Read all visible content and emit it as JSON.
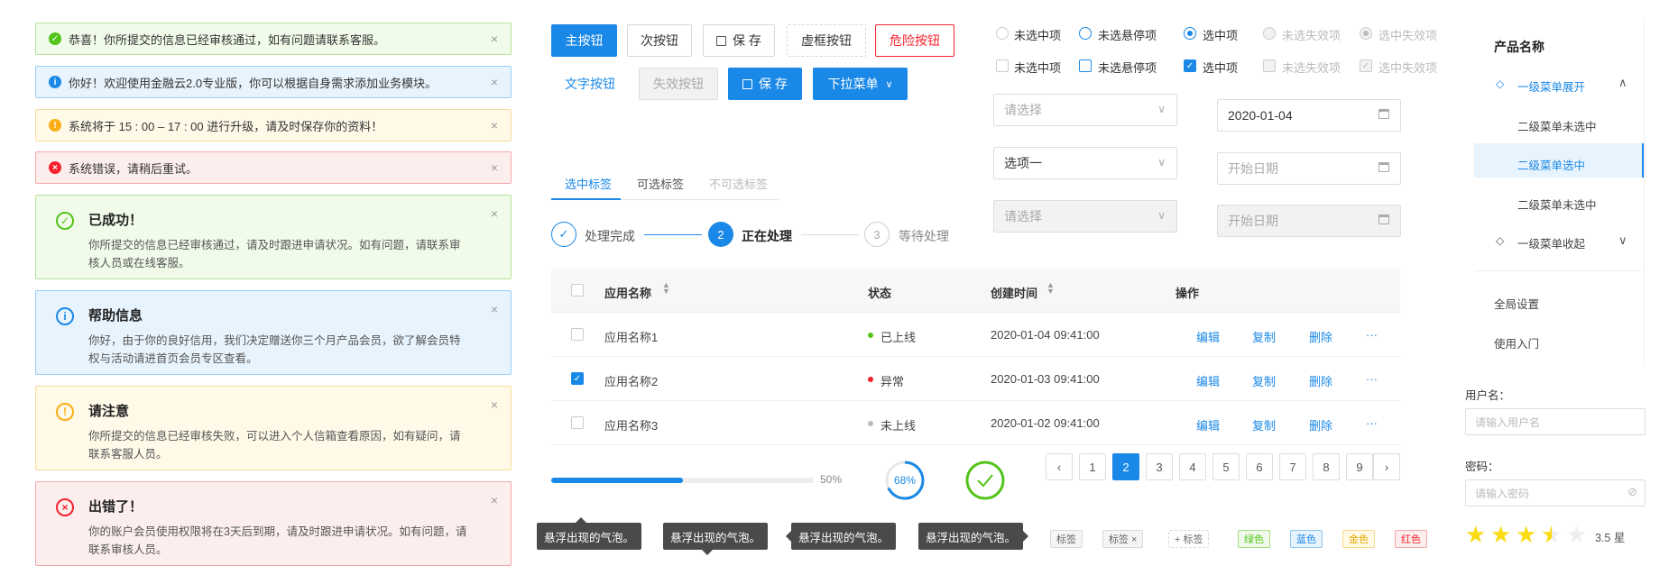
{
  "alerts_small": [
    {
      "type": "success",
      "text": "恭喜！你所提交的信息已经审核通过，如有问题请联系客服。"
    },
    {
      "type": "info",
      "text": "你好！欢迎使用金融云2.0专业版，你可以根据自身需求添加业务模块。"
    },
    {
      "type": "warning",
      "text": "系统将于 15 : 00 – 17 : 00 进行升级，请及时保存你的资料！"
    },
    {
      "type": "error",
      "text": "系统错误，请稍后重试。"
    }
  ],
  "alerts_big": [
    {
      "type": "success",
      "title": "已成功！",
      "desc": "你所提交的信息已经审核通过，请及时跟进申请状况。如有问题，请联系审核人员或在线客服。"
    },
    {
      "type": "info",
      "title": "帮助信息",
      "desc": "你好，由于你的良好信用，我们决定赠送你三个月产品会员，欲了解会员特权与活动请进首页会员专区查看。"
    },
    {
      "type": "warning",
      "title": "请注意",
      "desc": "你所提交的信息已经审核失败，可以进入个人信箱查看原因，如有疑问，请联系客服人员。"
    },
    {
      "type": "error",
      "title": "出错了！",
      "desc": "你的账户会员使用权限将在3天后到期，请及时跟进申请状况。如有问题，请联系审核人员。"
    }
  ],
  "alert_close": "×",
  "buttons": {
    "primary": "主按钮",
    "secondary": "次按钮",
    "save": "保 存",
    "dashed": "虚框按钮",
    "danger": "危险按钮",
    "text": "文字按钮",
    "disabled": "失效按钮",
    "save_primary": "保 存",
    "dropdown": "下拉菜单"
  },
  "tabs": [
    "选中标签",
    "可选标签",
    "不可选标签"
  ],
  "steps": [
    {
      "label": "处理完成",
      "num": "✓"
    },
    {
      "label": "正在处理",
      "num": "2"
    },
    {
      "label": "等待处理",
      "num": "3"
    }
  ],
  "table": {
    "headers": [
      "应用名称",
      "状态",
      "创建时间",
      "操作"
    ],
    "rows": [
      {
        "name": "应用名称1",
        "status": "已上线",
        "status_color": "#52c41a",
        "time": "2020-01-04  09:41:00",
        "checked": false
      },
      {
        "name": "应用名称2",
        "status": "异常",
        "status_color": "#f5222d",
        "time": "2020-01-03  09:41:00",
        "checked": true
      },
      {
        "name": "应用名称3",
        "status": "未上线",
        "status_color": "#bbbbbb",
        "time": "2020-01-02  09:41:00",
        "checked": false
      }
    ],
    "actions": [
      "编辑",
      "复制",
      "删除",
      "···"
    ]
  },
  "progress": {
    "value": 0.5,
    "label": "50%"
  },
  "circle_progress": {
    "value": 0.68,
    "label": "68%"
  },
  "pagination": {
    "prev": "‹",
    "next": "›",
    "pages": [
      "1",
      "2",
      "3",
      "4",
      "5",
      "6",
      "7",
      "8",
      "9"
    ],
    "current": "2"
  },
  "tooltip_text": "悬浮出现的气泡。",
  "tags": [
    {
      "text": "标签",
      "style": "plain"
    },
    {
      "text": "标签  ×",
      "style": "plain"
    },
    {
      "text": "+ 标签",
      "style": "dashed"
    },
    {
      "text": "绿色",
      "style": "green"
    },
    {
      "text": "蓝色",
      "style": "blue"
    },
    {
      "text": "金色",
      "style": "gold"
    },
    {
      "text": "红色",
      "style": "red"
    }
  ],
  "radios": [
    "未选中项",
    "未选悬停项",
    "选中项",
    "未选失效项",
    "选中失效项"
  ],
  "checkboxes": [
    "未选中项",
    "未选悬停项",
    "选中项",
    "未选失效项",
    "选中失效项"
  ],
  "selects": {
    "placeholder": "请选择",
    "selected": "选项一",
    "disabled": "请选择",
    "date_value": "2020-01-04",
    "date_placeholder": "开始日期",
    "date_disabled": "开始日期"
  },
  "menu": {
    "title": "产品名称",
    "open": "一级菜单展开",
    "sub": [
      "二级菜单未选中",
      "二级菜单选中",
      "二级菜单未选中"
    ],
    "closed": "一级菜单收起",
    "global": "全局设置",
    "guide": "使用入门"
  },
  "form": {
    "username_label": "用户名：",
    "username_placeholder": "请输入用户名",
    "password_label": "密码：",
    "password_placeholder": "请输入密码"
  },
  "rating": {
    "value": 3.5,
    "max": 5,
    "label": "3.5 星"
  },
  "colors": {
    "primary": "#1a88e6",
    "success": "#52c41a",
    "warning": "#faad14",
    "error": "#f5222d"
  }
}
